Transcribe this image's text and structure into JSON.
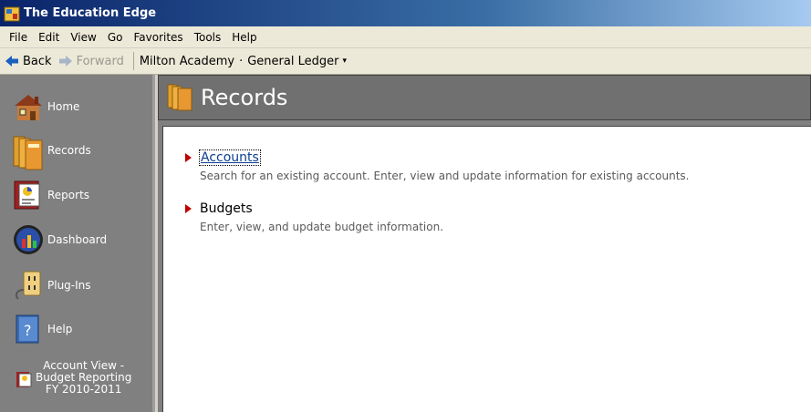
{
  "window": {
    "title": "The Education Edge"
  },
  "menu": [
    {
      "label": "File"
    },
    {
      "label": "Edit"
    },
    {
      "label": "View"
    },
    {
      "label": "Go"
    },
    {
      "label": "Favorites"
    },
    {
      "label": "Tools"
    },
    {
      "label": "Help"
    }
  ],
  "nav": {
    "back_label": "Back",
    "forward_label": "Forward",
    "breadcrumb": {
      "school": "Milton Academy",
      "separator": "·",
      "module": "General Ledger",
      "caret": "▾"
    }
  },
  "sidebar": {
    "items": [
      {
        "label": "Home",
        "icon": "house-icon"
      },
      {
        "label": "Records",
        "icon": "folders-icon"
      },
      {
        "label": "Reports",
        "icon": "report-book-icon"
      },
      {
        "label": "Dashboard",
        "icon": "dashboard-globe-icon"
      },
      {
        "label": "Plug-Ins",
        "icon": "plug-icon"
      },
      {
        "label": "Help",
        "icon": "help-book-icon"
      }
    ],
    "shortcut": {
      "line1": "Account View -",
      "line2": "Budget Reporting",
      "line3": "FY 2010-2011",
      "icon": "report-book-icon"
    }
  },
  "page": {
    "title": "Records",
    "entries": [
      {
        "title": "Accounts",
        "description": "Search for an existing account. Enter, view and update information for existing accounts."
      },
      {
        "title": "Budgets",
        "description": "Enter, view, and update budget information."
      }
    ]
  },
  "colors": {
    "title_bar": "#0a246a",
    "sidebar_bg": "#808080",
    "link": "#0b3d91",
    "arrow": "#c00000"
  }
}
